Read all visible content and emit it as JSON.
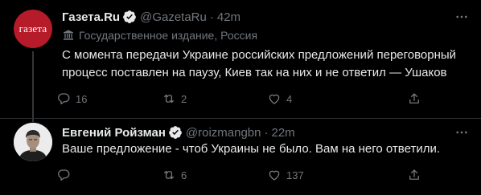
{
  "tweets": [
    {
      "avatar_text": "газета",
      "name": "Газета.Ru",
      "handle": "@GazetaRu",
      "separator": "·",
      "time": "42m",
      "label": "Государственное издание, Россия",
      "text": "С момента передачи Украине российских предложений переговорный процесс поставлен на паузу, Киев так на них и не ответил — Ушаков",
      "replies": "16",
      "retweets": "2",
      "likes": "4",
      "avatar_bg": "#b61b2a"
    },
    {
      "name": "Евгений Ройзман",
      "handle": "@roizmangbn",
      "separator": "·",
      "time": "22m",
      "text": "Ваше предложение - чтоб Украины не было. Вам на него ответили.",
      "replies": "",
      "retweets": "6",
      "likes": "137"
    }
  ],
  "colors": {
    "background": "#000000",
    "text": "#e7e9ea",
    "secondary": "#71767b",
    "verified": "#1d9bf0",
    "divider": "#2f3336"
  },
  "icons": {
    "verified": "verified-badge-icon",
    "government": "government-building-icon",
    "more": "more-dots-icon",
    "reply": "reply-icon",
    "retweet": "retweet-icon",
    "like": "heart-icon",
    "share": "share-icon"
  }
}
